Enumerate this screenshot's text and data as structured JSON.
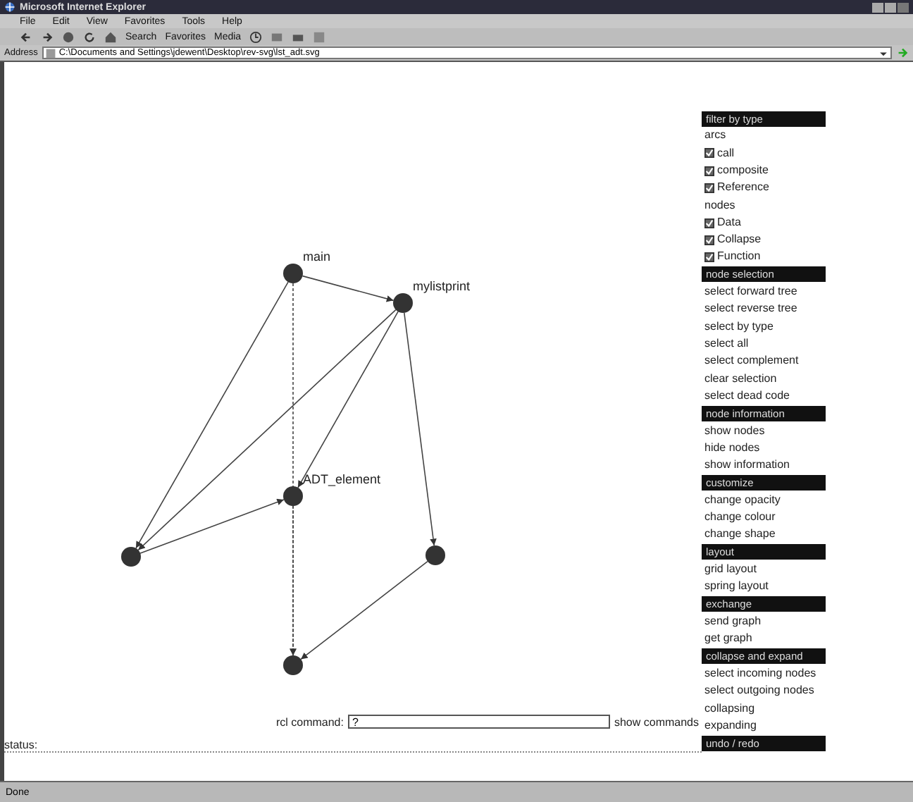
{
  "window": {
    "title": "Microsoft Internet Explorer"
  },
  "menu": [
    "File",
    "Edit",
    "View",
    "Favorites",
    "Tools",
    "Help"
  ],
  "toolbar": [
    "Search",
    "Favorites",
    "Media"
  ],
  "address": {
    "label": "Address",
    "value": "C:\\Documents and Settings\\jdewent\\Desktop\\rev-svg\\lst_adt.svg"
  },
  "graph": {
    "node_labels": [
      "main",
      "mylistprint",
      "ADT_element"
    ]
  },
  "command": {
    "label": "rcl command:",
    "value": "?",
    "link": "show commands"
  },
  "status_text": "status:",
  "sidebar": [
    {
      "title": "filter by type",
      "items": [
        {
          "kind": "label",
          "text": "arcs"
        },
        {
          "kind": "toggle",
          "text": "call",
          "checked": true
        },
        {
          "kind": "toggle",
          "text": "composite",
          "checked": true
        },
        {
          "kind": "toggle",
          "text": "Reference",
          "checked": true
        },
        {
          "kind": "label",
          "text": "nodes"
        },
        {
          "kind": "toggle",
          "text": "Data",
          "checked": true
        },
        {
          "kind": "toggle",
          "text": "Collapse",
          "checked": true
        },
        {
          "kind": "toggle",
          "text": "Function",
          "checked": true
        }
      ]
    },
    {
      "title": "node selection",
      "items": [
        {
          "kind": "link",
          "text": "select forward tree"
        },
        {
          "kind": "link",
          "text": "select reverse tree"
        },
        {
          "kind": "link",
          "text": "select by type"
        },
        {
          "kind": "link",
          "text": "select all"
        },
        {
          "kind": "link",
          "text": "select complement"
        },
        {
          "kind": "link",
          "text": "clear selection"
        },
        {
          "kind": "link",
          "text": "select dead code"
        }
      ]
    },
    {
      "title": "node information",
      "items": [
        {
          "kind": "link",
          "text": "show nodes"
        },
        {
          "kind": "link",
          "text": "hide nodes"
        },
        {
          "kind": "link",
          "text": "show information"
        }
      ]
    },
    {
      "title": "customize",
      "items": [
        {
          "kind": "link",
          "text": "change opacity"
        },
        {
          "kind": "link",
          "text": "change colour"
        },
        {
          "kind": "link",
          "text": "change shape"
        }
      ]
    },
    {
      "title": "layout",
      "items": [
        {
          "kind": "link",
          "text": "grid layout"
        },
        {
          "kind": "link",
          "text": "spring layout"
        }
      ]
    },
    {
      "title": "exchange",
      "items": [
        {
          "kind": "link",
          "text": "send graph"
        },
        {
          "kind": "link",
          "text": "get graph"
        }
      ]
    },
    {
      "title": "collapse and expand",
      "items": [
        {
          "kind": "link",
          "text": "select incoming nodes"
        },
        {
          "kind": "link",
          "text": "select outgoing nodes"
        },
        {
          "kind": "link",
          "text": "collapsing"
        },
        {
          "kind": "link",
          "text": "expanding"
        }
      ]
    },
    {
      "title": "undo / redo"
    }
  ],
  "status_bar": "Done"
}
